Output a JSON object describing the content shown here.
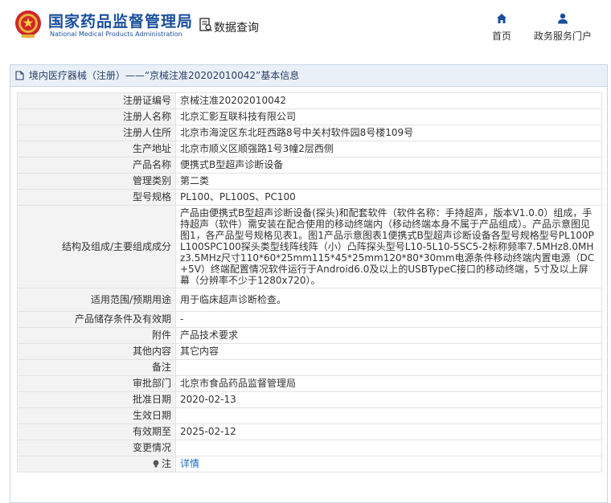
{
  "header": {
    "site_name_cn": "国家药品监督管理局",
    "site_name_en": "National Medical Products Administration",
    "data_query_label": "数据查询",
    "nav": [
      {
        "label": "首页",
        "icon": "home-icon"
      },
      {
        "label": "政务服务门户",
        "icon": "user-icon"
      }
    ]
  },
  "panel": {
    "title": "境内医疗器械（注册）——“京械注准20202010042”基本信息"
  },
  "rows": [
    {
      "label": "注册证编号",
      "value": "京械注准20202010042"
    },
    {
      "label": "注册人名称",
      "value": "北京汇影互联科技有限公司"
    },
    {
      "label": "注册人住所",
      "value": "北京市海淀区东北旺西路8号中关村软件园8号楼109号"
    },
    {
      "label": "生产地址",
      "value": "北京市顺义区顺强路1号3幢2层西侧"
    },
    {
      "label": "产品名称",
      "value": "便携式B型超声诊断设备"
    },
    {
      "label": "管理类别",
      "value": "第二类"
    },
    {
      "label": "型号规格",
      "value": "PL100、PL100S、PC100"
    },
    {
      "label": "结构及组成/主要组成成分",
      "value": "产品由便携式B型超声诊断设备(探头)和配套软件（软件名称：手持超声，版本V1.0.0）组成，手持超声（软件）需安装在配合使用的移动终端内（移动终端本身不属于产品组成）。产品示意图见图1，各产品型号规格见表1。图1产品示意图表1便携式B型超声诊断设备各型号规格型号PL100PL100SPC100探头类型线阵线阵（小）凸阵探头型号L10-5L10-5SC5-2标称频率7.5MHz8.0MHz3.5MHz尺寸110*60*25mm115*45*25mm120*80*30mm电源条件移动终端内置电源（DC+5V）终端配置情况软件运行于Android6.0及以上的USBTypeC接口的移动终端，5寸及以上屏幕（分辨率不少于1280x720）。"
    },
    {
      "label": "适用范围/预期用途",
      "value": "用于临床超声诊断检查。"
    },
    {
      "label": "产品储存条件及有效期",
      "value": "-"
    },
    {
      "label": "附件",
      "value": "产品技术要求"
    },
    {
      "label": "其他内容",
      "value": "其它内容"
    },
    {
      "label": "备注",
      "value": ""
    },
    {
      "label": "审批部门",
      "value": "北京市食品药品监督管理局"
    },
    {
      "label": "批准日期",
      "value": "2020-02-13"
    },
    {
      "label": "生效日期",
      "value": ""
    },
    {
      "label": "有效期至",
      "value": "2025-02-12"
    },
    {
      "label": "变更情况",
      "value": ""
    }
  ],
  "note_row": {
    "label": "注",
    "link": "详情"
  },
  "colors": {
    "brand_blue": "#1a4f9c",
    "emblem_red": "#d0262a",
    "link": "#1a6cc4",
    "head_bg": "#e9f0f8"
  }
}
